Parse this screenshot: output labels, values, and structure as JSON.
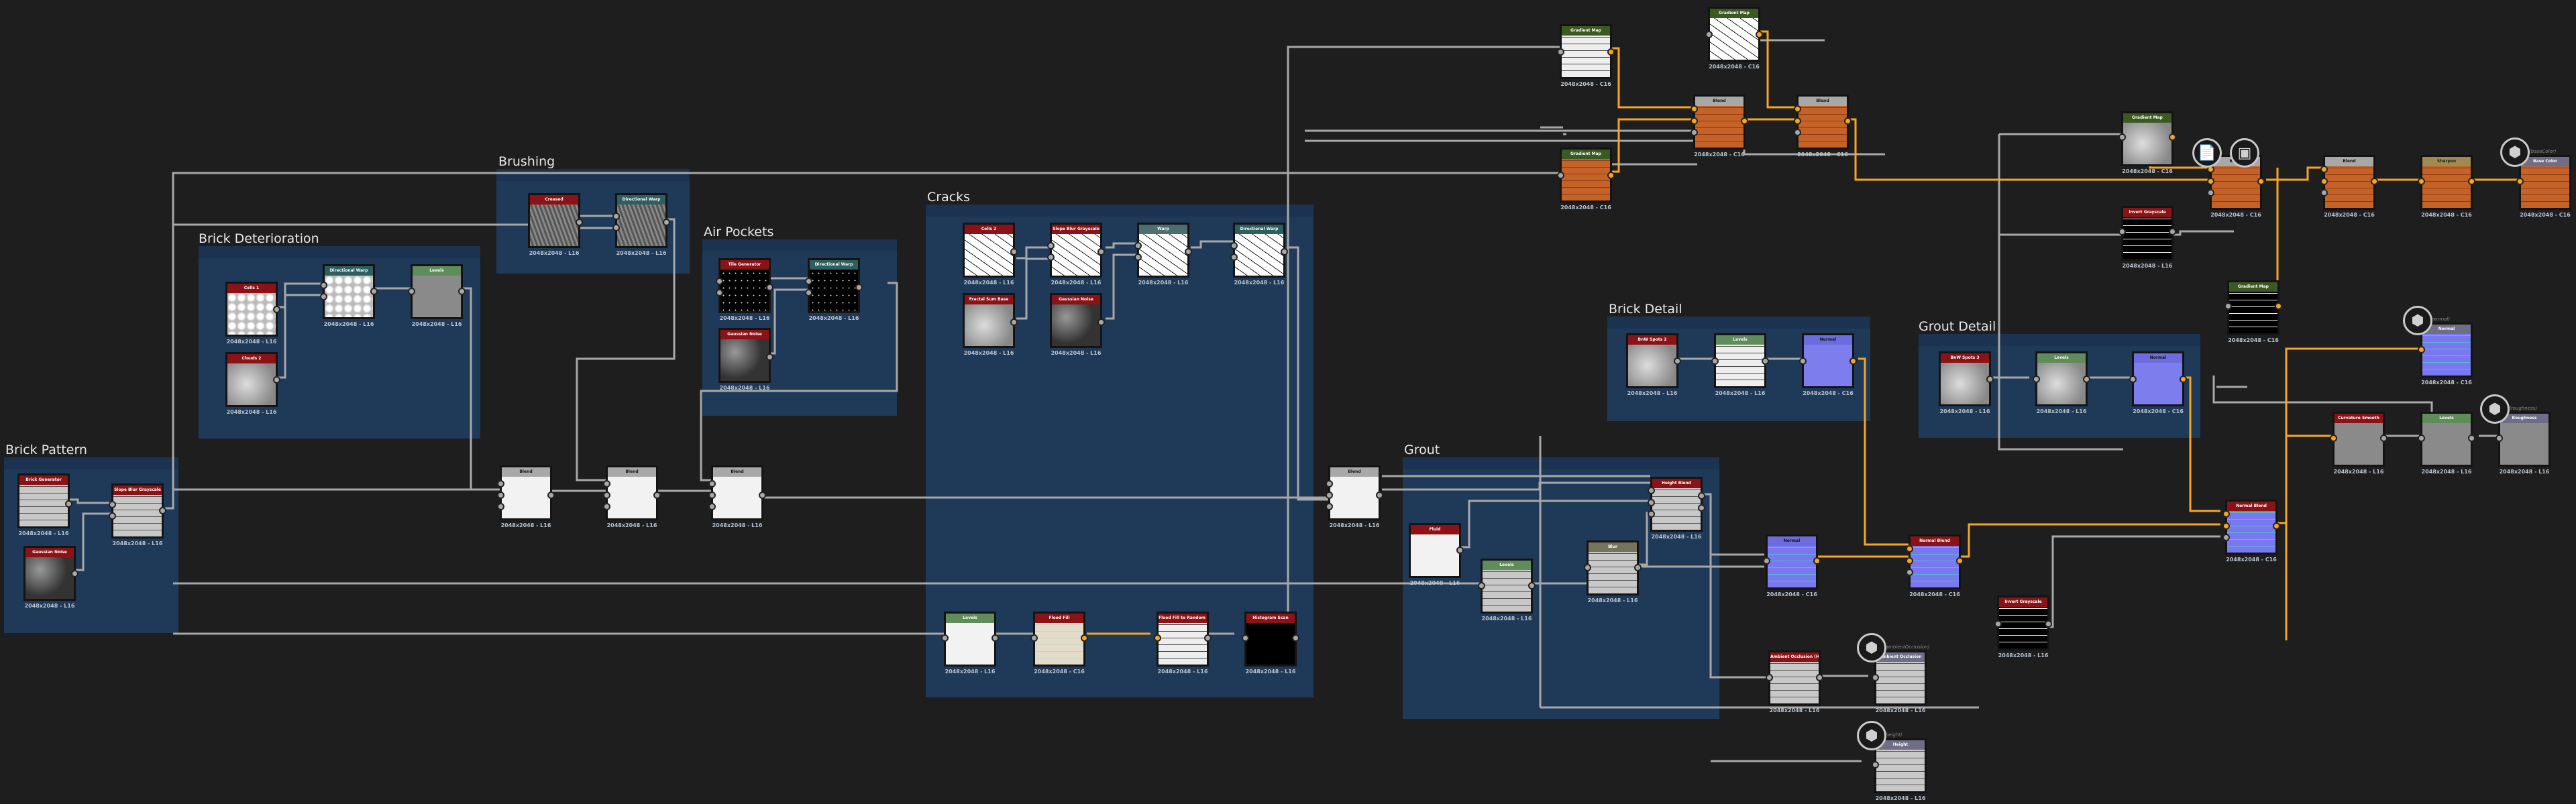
{
  "frames": {
    "brick_pattern": "Brick Pattern",
    "brick_deterioration": "Brick Deterioration",
    "brushing": "Brushing",
    "air_pockets": "Air Pockets",
    "cracks": "Cracks",
    "grout": "Grout",
    "brick_detail": "Brick Detail",
    "grout_detail": "Grout Detail"
  },
  "nodes": {
    "brick_generator": {
      "title": "Brick Generator",
      "res": "2048x2048 - L16"
    },
    "slope_blur_1": {
      "title": "Slope Blur Grayscale",
      "res": "2048x2048 - L16"
    },
    "gaussian_noise_1": {
      "title": "Gaussian Noise",
      "res": "2048x2048 - L16"
    },
    "cells_1": {
      "title": "Cells 1",
      "res": "2048x2048 - L16"
    },
    "clouds_2": {
      "title": "Clouds 2",
      "res": "2048x2048 - L16"
    },
    "dir_warp_1": {
      "title": "Directional Warp",
      "res": "2048x2048 - L16"
    },
    "levels_1": {
      "title": "Levels",
      "res": "2048x2048 - L16"
    },
    "creased": {
      "title": "Creased",
      "res": "2048x2048 - L16"
    },
    "dir_warp_2": {
      "title": "Directional Warp",
      "res": "2048x2048 - L16"
    },
    "tile_generator": {
      "title": "Tile Generator",
      "res": "2048x2048 - L16"
    },
    "dir_warp_3": {
      "title": "Directional Warp",
      "res": "2048x2048 - L16"
    },
    "gaussian_noise_2": {
      "title": "Gaussian Noise",
      "res": "2048x2048 - L16"
    },
    "cells_2": {
      "title": "Cells 2",
      "res": "2048x2048 - L16"
    },
    "slope_blur_2": {
      "title": "Slope Blur Grayscale",
      "res": "2048x2048 - L16"
    },
    "warp": {
      "title": "Warp",
      "res": "2048x2048 - L16"
    },
    "dir_warp_4": {
      "title": "Directional Warp",
      "res": "2048x2048 - L16"
    },
    "fractal_sum": {
      "title": "Fractal Sum Base",
      "res": "2048x2048 - L16"
    },
    "gaussian_noise_3": {
      "title": "Gaussian Noise",
      "res": "2048x2048 - L16"
    },
    "levels_cracks": {
      "title": "Levels",
      "res": "2048x2048 - L16"
    },
    "flood_fill": {
      "title": "Flood Fill",
      "res": "2048x2048 - C16"
    },
    "flood_fill_random": {
      "title": "Flood Fill to Random G...",
      "res": "2048x2048 - L16"
    },
    "histogram_scan": {
      "title": "Histogram Scan",
      "res": "2048x2048 - L16"
    },
    "blend_1": {
      "title": "Blend",
      "res": "2048x2048 - L16"
    },
    "blend_2": {
      "title": "Blend",
      "res": "2048x2048 - L16"
    },
    "blend_3": {
      "title": "Blend",
      "res": "2048x2048 - L16"
    },
    "blend_4": {
      "title": "Blend",
      "res": "2048x2048 - L16"
    },
    "fluid": {
      "title": "Fluid",
      "res": "2048x2048 - L16"
    },
    "levels_grout": {
      "title": "Levels",
      "res": "2048x2048 - L16"
    },
    "blur": {
      "title": "Blur",
      "res": "2048x2048 - L16"
    },
    "height_blend": {
      "title": "Height Blend",
      "res": "2048x2048 - L16"
    },
    "bnw_spots_2": {
      "title": "BnW Spots 2",
      "res": "2048x2048 - L16"
    },
    "levels_bd": {
      "title": "Levels",
      "res": "2048x2048 - L16"
    },
    "normal_bd": {
      "title": "Normal",
      "res": "2048x2048 - C16"
    },
    "bnw_spots_3": {
      "title": "BnW Spots 3",
      "res": "2048x2048 - L16"
    },
    "levels_gd": {
      "title": "Levels",
      "res": "2048x2048 - L16"
    },
    "normal_gd": {
      "title": "Normal",
      "res": "2048x2048 - C16"
    },
    "gradient_map_1": {
      "title": "Gradient Map",
      "res": "2048x2048 - C16"
    },
    "gradient_map_2": {
      "title": "Gradient Map",
      "res": "2048x2048 - C16"
    },
    "gradient_map_3": {
      "title": "Gradient Map",
      "res": "2048x2048 - C16"
    },
    "blend_c1": {
      "title": "Blend",
      "res": "2048x2048 - C16"
    },
    "blend_c2": {
      "title": "Blend",
      "res": "2048x2048 - C16"
    },
    "gradient_map_4": {
      "title": "Gradient Map",
      "res": "2048x2048 - C16"
    },
    "invert_gray_1": {
      "title": "Invert Grayscale",
      "res": "2048x2048 - L16"
    },
    "blend_c3": {
      "title": "Blend",
      "res": "2048x2048 - C16"
    },
    "blend_c4": {
      "title": "Blend",
      "res": "2048x2048 - C16"
    },
    "sharpen": {
      "title": "Sharpen",
      "res": "2048x2048 - C16"
    },
    "base_color": {
      "title": "Base Color",
      "res": "2048x2048 - C16",
      "output_label": "(baseColor)"
    },
    "gradient_map_5": {
      "title": "Gradient Map",
      "res": "2048x2048 - C16"
    },
    "normal_main": {
      "title": "Normal",
      "res": "2048x2048 - C16"
    },
    "normal_blend_1": {
      "title": "Normal Blend",
      "res": "2048x2048 - C16"
    },
    "invert_gray_2": {
      "title": "Invert Grayscale",
      "res": "2048x2048 - L16"
    },
    "normal_blend_2": {
      "title": "Normal Blend",
      "res": "2048x2048 - C16"
    },
    "normal_out": {
      "title": "Normal",
      "res": "2048x2048 - C16",
      "output_label": "(normal)"
    },
    "curvature_smooth": {
      "title": "Curvature Smooth",
      "res": "2048x2048 - L16"
    },
    "levels_rough": {
      "title": "Levels",
      "res": "2048x2048 - L16"
    },
    "roughness_out": {
      "title": "Roughness",
      "res": "2048x2048 - L16",
      "output_label": "(roughness)"
    },
    "ao_hbao": {
      "title": "Ambient Occlusion (HB...",
      "res": "2048x2048 - L16"
    },
    "ao_out": {
      "title": "Ambient Occlusion",
      "res": "2048x2048 - L16",
      "output_label": "(ambientOcclusion)"
    },
    "height_out": {
      "title": "Height",
      "res": "2048x2048 - L16",
      "output_label": "(height)"
    }
  },
  "icons": {
    "comment": "document-icon",
    "preview": "checker-icon",
    "output": "cube-icon"
  },
  "colors": {
    "background": "#1e1e1e",
    "frame": "#1f3a59",
    "wire_gray": "#a8a8a8",
    "wire_color": "#f5a623",
    "header_generator": "#8b1216",
    "header_filter": "#5f8c5a",
    "header_output": "#6e6e86"
  }
}
